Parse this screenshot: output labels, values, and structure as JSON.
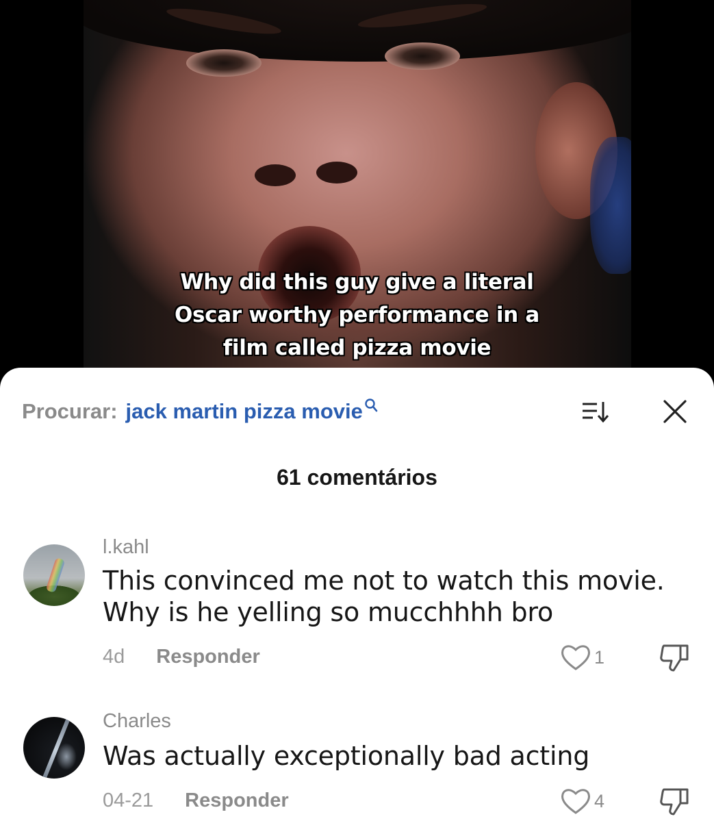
{
  "video": {
    "caption_lines": [
      "Why did this guy give a literal",
      "Oscar worthy performance in a",
      "film called pizza movie"
    ]
  },
  "search": {
    "prefix": "Procurar:",
    "query": "jack martin pizza movie"
  },
  "comments_header": {
    "count_label": "61 comentários"
  },
  "comments": [
    {
      "username": "l.kahl",
      "text_lines": [
        "This convinced me not to watch this movie.",
        "Why is he yelling so mucchhhh bro"
      ],
      "date": "4d",
      "reply_label": "Responder",
      "likes": "1"
    },
    {
      "username": "Charles",
      "text_lines": [
        "Was actually exceptionally bad acting"
      ],
      "date": "04-21",
      "reply_label": "Responder",
      "likes": "4"
    }
  ],
  "icons": {
    "search": "search-icon",
    "sort": "sort-icon",
    "close": "close-icon",
    "like": "heart-icon",
    "dislike": "thumbs-down-icon"
  },
  "colors": {
    "link": "#2a5db0",
    "muted": "#8a8a8a",
    "text": "#161616"
  }
}
